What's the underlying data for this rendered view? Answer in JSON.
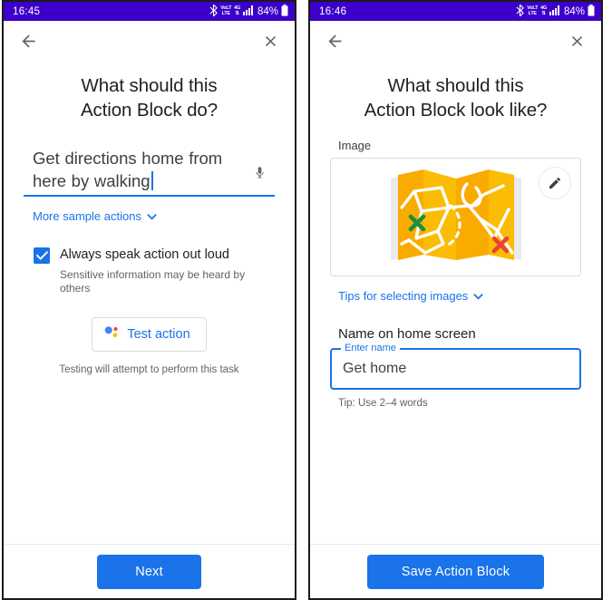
{
  "screens": [
    {
      "statusbar": {
        "time": "16:45",
        "icons": [
          "bluetooth-icon",
          "volte-icon",
          "4g-icon",
          "signal-bars-icon"
        ],
        "volte_top": "VoLT",
        "volte_bottom": "LTE",
        "net_top": "4G",
        "net_bottom": "⇅",
        "battery_percent": "84%"
      },
      "appbar": {
        "back": "back-arrow-icon",
        "close": "close-icon"
      },
      "title": "What should this\nAction Block do?",
      "title_line1": "What should this",
      "title_line2": "Action Block do?",
      "action_input": {
        "value": "Get directions home from here by walking",
        "placeholder": "Get directions home from here by walking",
        "mic": "microphone-icon"
      },
      "more_samples_label": "More sample actions",
      "speak_checkbox": {
        "checked": true,
        "label": "Always speak action out loud",
        "sublabel": "Sensitive information may be heard by others"
      },
      "test_button_label": "Test action",
      "test_note": "Testing will attempt to perform this task",
      "primary_button_label": "Next"
    },
    {
      "statusbar": {
        "time": "16:46",
        "icons": [
          "bluetooth-icon",
          "volte-icon",
          "4g-icon",
          "signal-bars-icon"
        ],
        "volte_top": "VoLT",
        "volte_bottom": "LTE",
        "net_top": "4G",
        "net_bottom": "⇅",
        "battery_percent": "84%"
      },
      "appbar": {
        "back": "back-arrow-icon",
        "close": "close-icon"
      },
      "title_line1": "What should this",
      "title_line2": "Action Block look like?",
      "image_section": {
        "label": "Image",
        "illustration": "folded-map-illustration",
        "edit_icon": "pencil-icon",
        "colors": {
          "map_primary": "#f9ab00",
          "map_secondary": "#fbbc04",
          "map_fold": "#e8eaed",
          "marker_start": "#1e8e3e",
          "marker_end": "#ea4335",
          "road": "#ffffff"
        }
      },
      "tips_label": "Tips for selecting images",
      "name_section": {
        "title": "Name on home screen",
        "float_label": "Enter name",
        "value": "Get home",
        "hint": "Tip: Use 2–4 words"
      },
      "primary_button_label": "Save Action Block"
    }
  ],
  "theme": {
    "accent": "#1a73e8",
    "statusbar_bg": "#3c00c8",
    "text_primary": "#202124",
    "text_secondary": "#5f6368",
    "border": "#dadce0"
  }
}
